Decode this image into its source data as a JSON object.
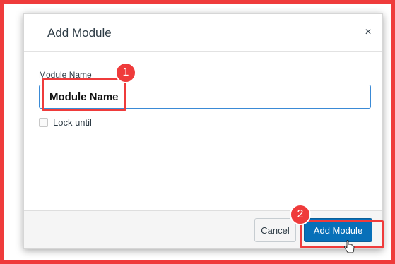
{
  "dialog": {
    "title": "Add Module",
    "close_label": "×"
  },
  "form": {
    "name_label": "Module Name",
    "name_value": "Module Name",
    "lock_label": "Lock until"
  },
  "footer": {
    "cancel_label": "Cancel",
    "add_label": "Add Module"
  },
  "annotations": {
    "step1": "1",
    "step2": "2"
  },
  "colors": {
    "annotation_red": "#ef3b3b",
    "primary_button": "#0770b9",
    "input_focus_border": "#3a8ad6"
  }
}
